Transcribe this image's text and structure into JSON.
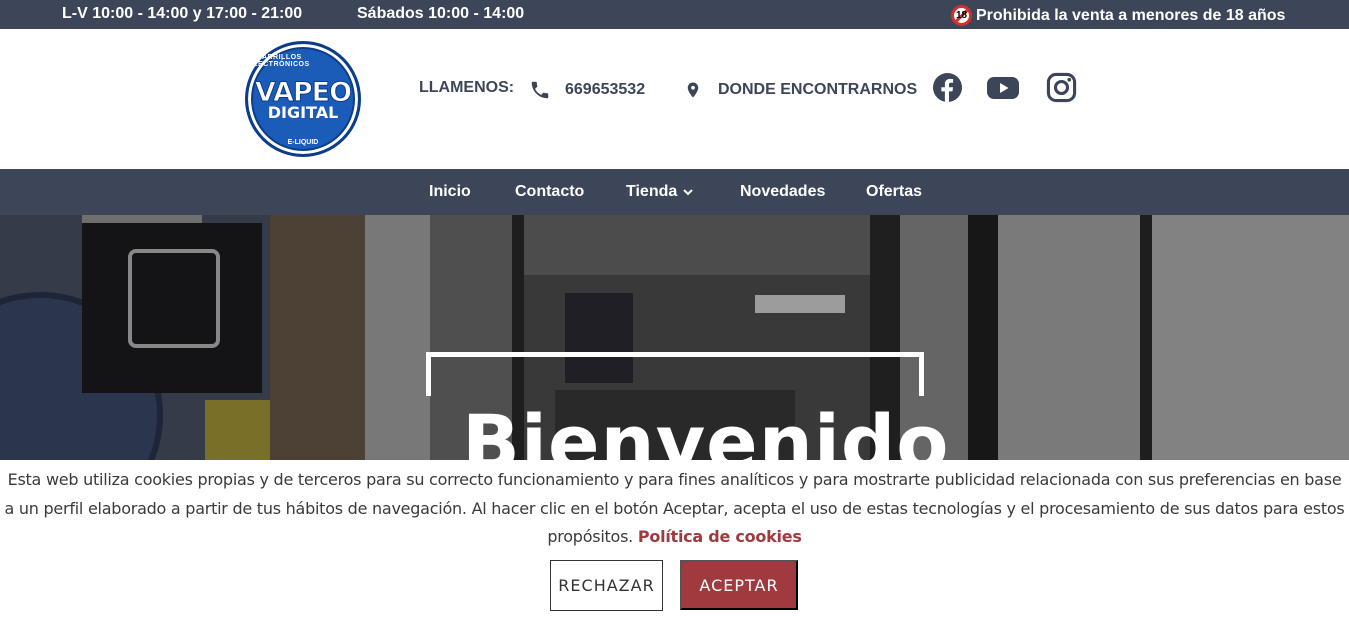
{
  "colors": {
    "topbar_bg": "#3d4659",
    "nav_bg": "#3d4659",
    "accent": "#a13a3f",
    "logo_blue": "#1a5cb8",
    "text_dark": "#3d4659"
  },
  "topbar": {
    "hours_weekdays": "L-V 10:00 - 14:00 y 17:00 - 21:00",
    "hours_saturday": "Sábados 10:00 - 14:00",
    "age_badge": "18",
    "age_notice": "Prohibida la venta a menores de 18 años"
  },
  "header": {
    "logo": {
      "arc_top": "CIGARRILLOS ELECTRÓNICOS",
      "line1": "VAPEO",
      "line2": "DIGITAL",
      "arc_bottom": "E-LIQUID"
    },
    "call_label": "LLAMENOS:",
    "phone": "669653532",
    "where_label": "DONDE ENCONTRARNOS",
    "social_icons": [
      "facebook-icon",
      "youtube-icon",
      "instagram-icon"
    ]
  },
  "nav": {
    "items": [
      {
        "label": "Inicio"
      },
      {
        "label": "Contacto"
      },
      {
        "label": "Tienda"
      },
      {
        "label": "Novedades"
      },
      {
        "label": "Ofertas"
      }
    ]
  },
  "hero": {
    "title": "Bienvenido"
  },
  "cookie_banner": {
    "text": "Esta web utiliza cookies propias y de terceros para su correcto funcionamiento y para fines analíticos y para mostrarte publicidad relacionada con sus preferencias en base a un perfil elaborado a partir de tus hábitos de navegación. Al hacer clic en el botón Aceptar, acepta el uso de estas tecnologías y el procesamiento de sus datos para estos propósitos.",
    "policy_link": "Política de cookies",
    "reject_label": "RECHAZAR",
    "accept_label": "ACEPTAR"
  }
}
